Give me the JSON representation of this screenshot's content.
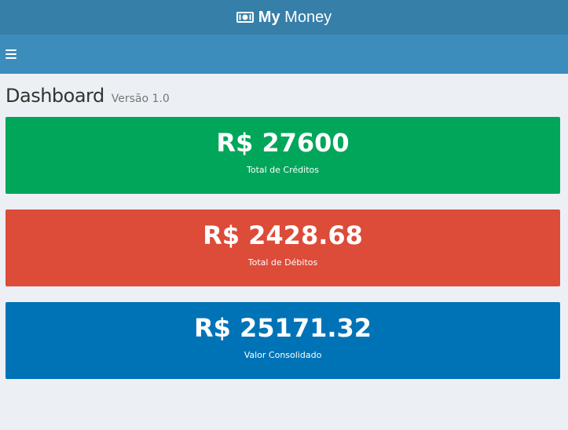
{
  "app": {
    "title_bold": "My",
    "title_rest": "Money",
    "icon": "money-bill-icon"
  },
  "navbar": {
    "toggle_icon": "hamburger-menu-icon"
  },
  "page": {
    "title": "Dashboard",
    "subtitle": "Versão 1.0"
  },
  "cards": {
    "credits": {
      "value": "R$ 27600",
      "label": "Total de Créditos",
      "color": "#00a65a"
    },
    "debits": {
      "value": "R$ 2428.68",
      "label": "Total de Débitos",
      "color": "#dd4b39"
    },
    "consolidated": {
      "value": "R$ 25171.32",
      "label": "Valor Consolidado",
      "color": "#0073b7"
    }
  },
  "colors": {
    "topbar": "#367fa9",
    "navbar": "#3c8dbc",
    "background": "#ecf0f5"
  }
}
